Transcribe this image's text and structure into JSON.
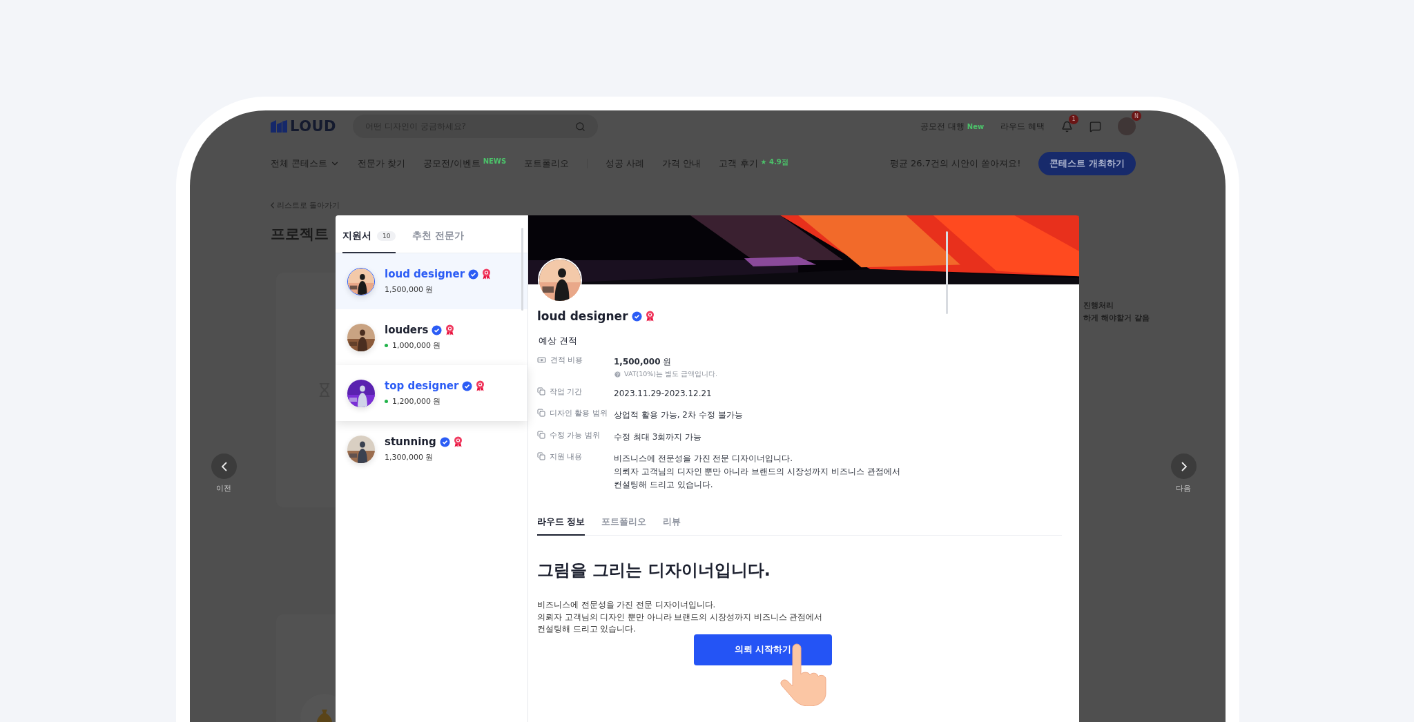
{
  "header": {
    "logo": "LOUD",
    "search": {
      "placeholder": "어떤 디자인이 궁금하세요?"
    },
    "links": [
      {
        "label": "공모전 대행",
        "badge": "New"
      },
      {
        "label": "라우드 혜택"
      }
    ],
    "notification_badge": "1",
    "avatar_badge": "N"
  },
  "nav": {
    "items": [
      {
        "label": "전체 콘테스트",
        "kind": "dropdown"
      },
      {
        "label": "전문가 찾기",
        "kind": "link"
      },
      {
        "label": "공모전/이벤트",
        "kind": "link",
        "badge": "NEWS"
      },
      {
        "label": "포트폴리오",
        "kind": "link"
      },
      {
        "label": "성공 사례",
        "kind": "link"
      },
      {
        "label": "가격 안내",
        "kind": "link"
      },
      {
        "label": "고객 후기",
        "kind": "link",
        "badge": "★ 4.9점"
      }
    ],
    "promo": "평균 26.7건의 시안이 쏟아져요!",
    "cta": "콘테스트 개최하기"
  },
  "page": {
    "back_link": "리스트로 돌아가기",
    "title": "프로젝트",
    "side_notes": [
      "진행처리",
      "하게 해야할거 같음"
    ]
  },
  "pager": {
    "prev": "이전",
    "next": "다음"
  },
  "modal": {
    "tabs": [
      {
        "label": "지원서",
        "count": "10",
        "selected": true
      },
      {
        "label": "추천 전문가",
        "selected": false
      }
    ],
    "applicants": [
      {
        "name": "loud designer",
        "price": "1,500,000 원",
        "selected": true,
        "hovered": false,
        "online": false
      },
      {
        "name": "louders",
        "price": "1,000,000 원",
        "selected": false,
        "hovered": false,
        "online": true
      },
      {
        "name": "top designer",
        "price": "1,200,000 원",
        "selected": false,
        "hovered": true,
        "online": true
      },
      {
        "name": "stunning",
        "price": "1,300,000 원",
        "selected": false,
        "hovered": false,
        "online": false
      }
    ],
    "profile": {
      "name": "loud designer",
      "estimate_title": "예상 견적",
      "rows": [
        {
          "kind": "cost",
          "label": "견적 비용",
          "value": "**1,500,000** 원",
          "note": "VAT(10%)는 별도 금액입니다."
        },
        {
          "kind": "doc",
          "label": "작업 기간",
          "value": "2023.11.29-2023.12.21"
        },
        {
          "kind": "doc",
          "label": "디자인 활용 범위",
          "value": "상업적 활용 가능, 2차 수정 불가능"
        },
        {
          "kind": "doc",
          "label": "수정 가능 범위",
          "value": "수정 최대 3회까지 가능"
        },
        {
          "kind": "doc",
          "label": "지원 내용",
          "value": "비즈니스에 전문성을 가진 전문 디자이너입니다.\n의뢰자 고객님의 디자인 뿐만 아니라 브랜드의 시장성까지 비즈니스 관점에서\n컨설팅해 드리고 있습니다."
        }
      ],
      "tabs": [
        {
          "label": "라우드 정보",
          "selected": true
        },
        {
          "label": "포트폴리오",
          "selected": false
        },
        {
          "label": "리뷰",
          "selected": false
        }
      ],
      "headline": "그림을 그리는 디자이너입니다.",
      "bio": "비즈니스에 전문성을 가진 전문 디자이너입니다.\n의뢰자 고객님의 디자인 뿐만 아니라 브랜드의 시장성까지 비즈니스 관점에서\n컨설팅해 드리고 있습니다.",
      "button": "의뢰 시작하기"
    }
  }
}
